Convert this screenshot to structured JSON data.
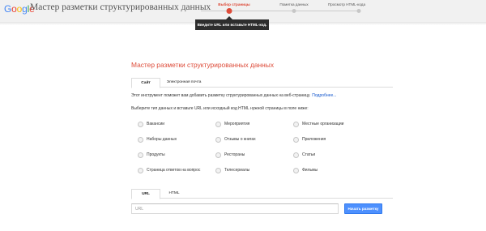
{
  "header": {
    "logo": [
      {
        "ch": "G",
        "color": "#4285f4"
      },
      {
        "ch": "o",
        "color": "#ea4335"
      },
      {
        "ch": "o",
        "color": "#fbbc05"
      },
      {
        "ch": "g",
        "color": "#4285f4"
      },
      {
        "ch": "l",
        "color": "#34a853"
      },
      {
        "ch": "e",
        "color": "#ea4335"
      }
    ],
    "title": "Мастер разметки структурированных данных"
  },
  "steps": [
    {
      "label": "Выбор страницы",
      "active": true
    },
    {
      "label": "Пометка данных",
      "active": false
    },
    {
      "label": "Просмотр HTML-кода",
      "active": false
    }
  ],
  "tooltip": "Введите URL или вставьте HTML-код.",
  "main": {
    "title": "Мастер разметки структурированных данных",
    "tabs": [
      {
        "label": "Сайт",
        "active": true
      },
      {
        "label": "Электронная почта",
        "active": false
      }
    ],
    "intro": "Этот инструмент поможет вам добавить разметку структурированных данных на веб-страницу.",
    "intro_link": "Подробнее...",
    "prompt": "Выберите тип данных и вставьте URL или исходный код HTML нужной страницы в поле ниже:"
  },
  "data_types": [
    [
      "Вакансии",
      "Мероприятия",
      "Местные организации"
    ],
    [
      "Наборы данных",
      "Отзывы о книгах",
      "Приложения"
    ],
    [
      "Продукты",
      "Рестораны",
      "Статьи"
    ],
    [
      "Страница ответов на вопрос",
      "Телесериалы",
      "Фильмы"
    ]
  ],
  "page_tabs": [
    {
      "label": "URL",
      "active": true
    },
    {
      "label": "HTML",
      "active": false
    }
  ],
  "url_input": {
    "placeholder": "URL",
    "value": ""
  },
  "extract_button": "Начать разметку",
  "colors": {
    "accent": "#dd4b39",
    "button": "#4d90fe",
    "link": "#1155cc"
  }
}
